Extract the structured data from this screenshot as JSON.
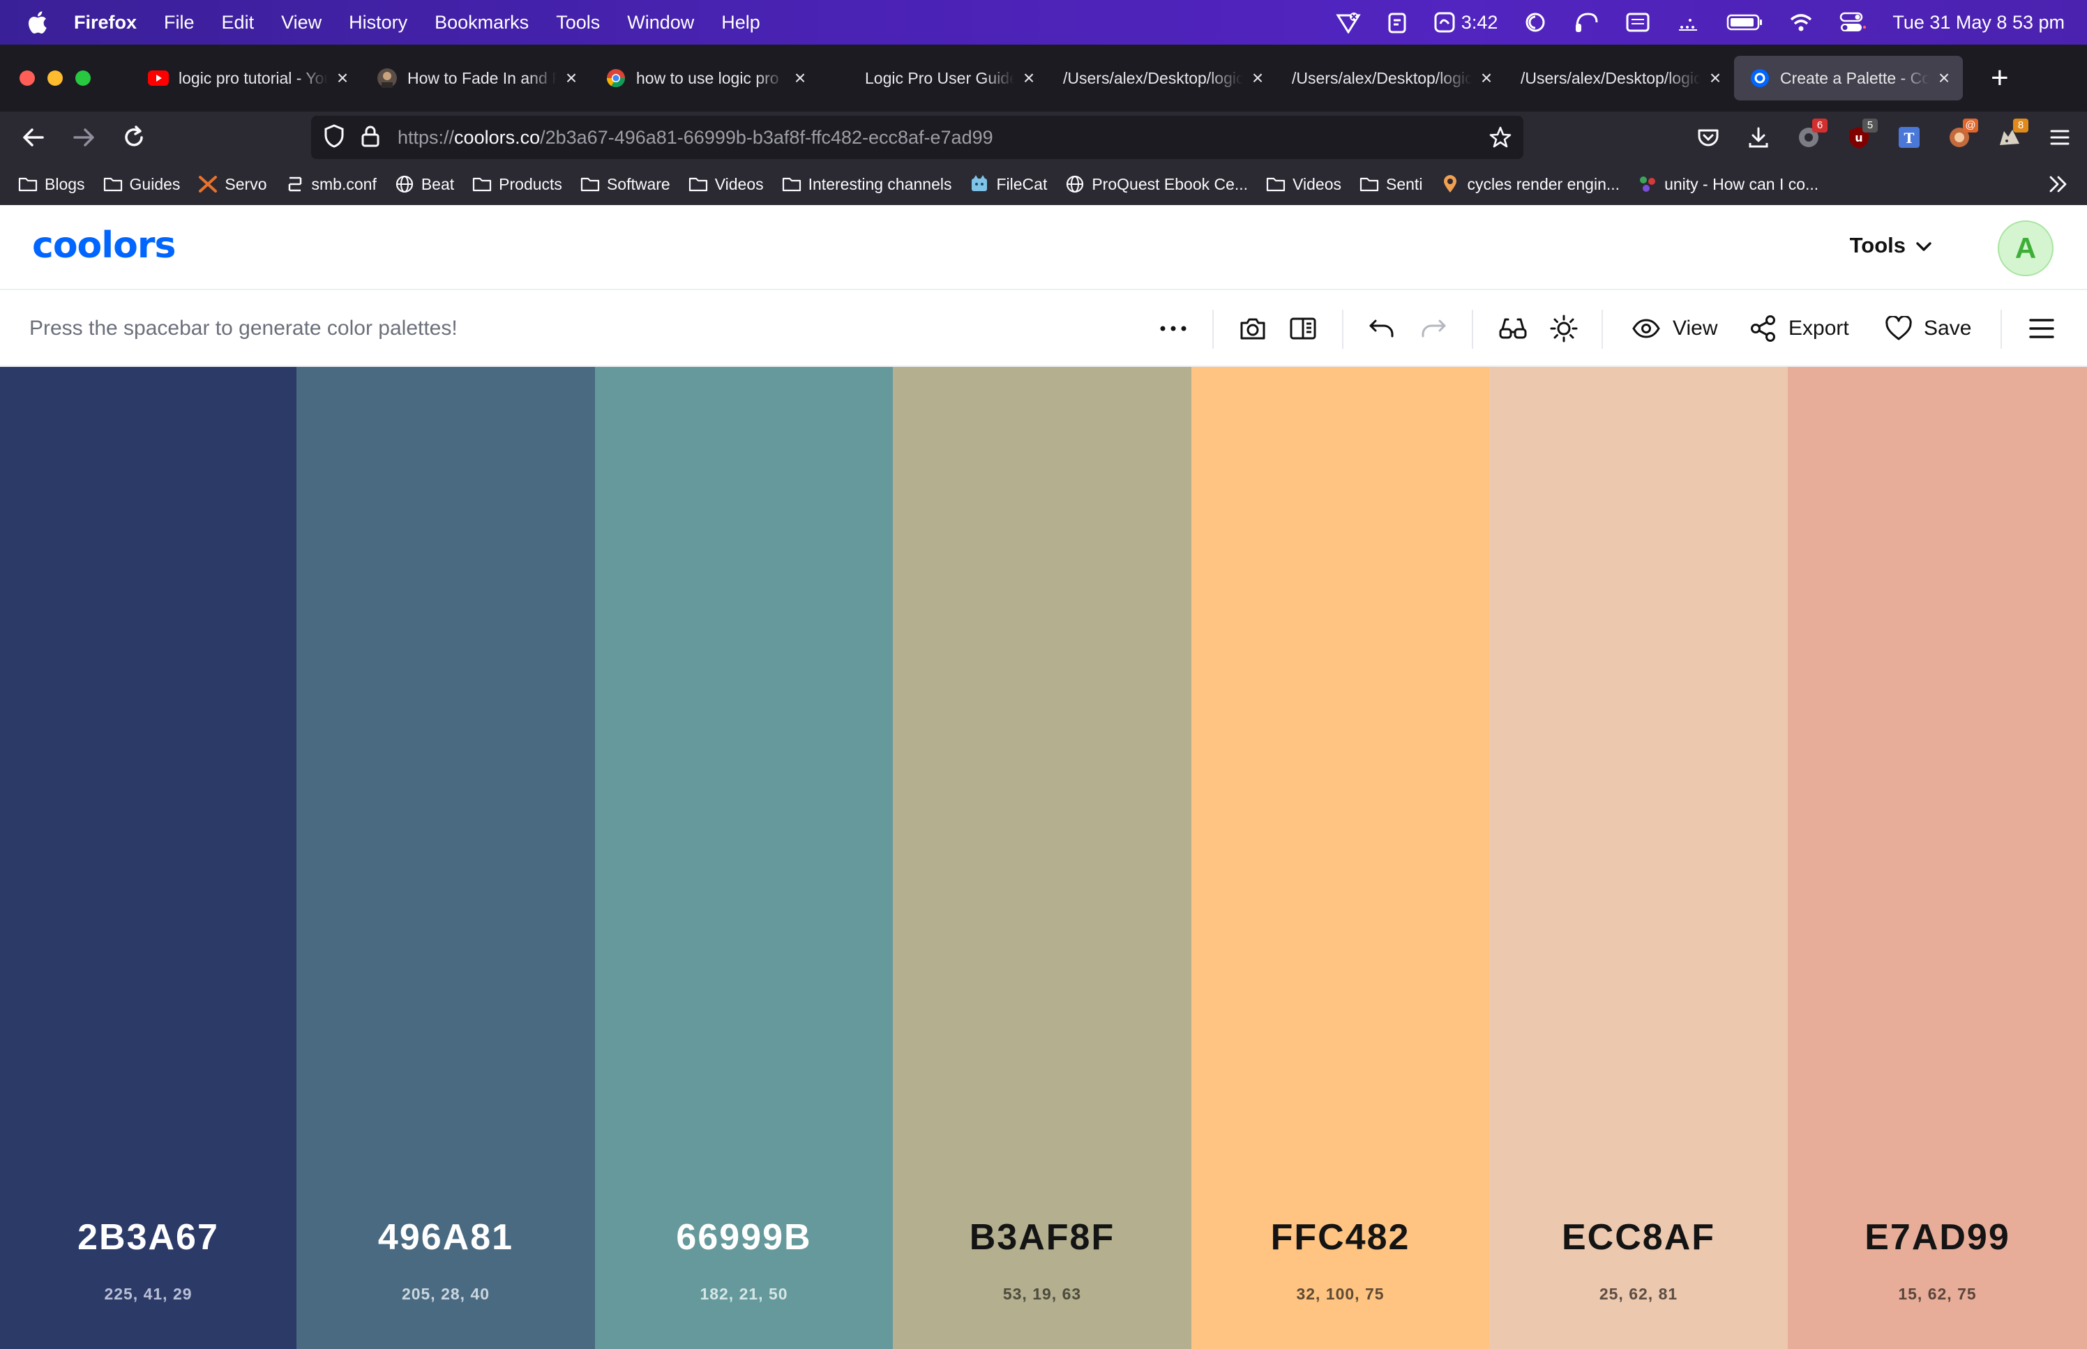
{
  "menubar": {
    "app_name": "Firefox",
    "items": [
      "File",
      "Edit",
      "View",
      "History",
      "Bookmarks",
      "Tools",
      "Window",
      "Help"
    ],
    "timer": "3:42",
    "datetime": "Tue 31 May  8 53 pm"
  },
  "tabs": [
    {
      "title": "logic pro tutorial - YouTube",
      "icon": "youtube-icon",
      "active": false
    },
    {
      "title": "How to Fade In and Fade Out",
      "icon": "avatar-icon",
      "active": false
    },
    {
      "title": "how to use logic pro",
      "icon": "chrome-icon",
      "active": false
    },
    {
      "title": "Logic Pro User Guide - logic",
      "icon": "",
      "active": false
    },
    {
      "title": "/Users/alex/Desktop/logic",
      "icon": "",
      "active": false
    },
    {
      "title": "/Users/alex/Desktop/logic",
      "icon": "",
      "active": false
    },
    {
      "title": "/Users/alex/Desktop/logic",
      "icon": "",
      "active": false
    },
    {
      "title": "Create a Palette - Coolors",
      "icon": "coolors-icon",
      "active": true
    }
  ],
  "urlbar": {
    "scheme": "https://",
    "host": "coolors.co",
    "path": "/2b3a67-496a81-66999b-b3af8f-ffc482-ecc8af-e7ad99"
  },
  "extensions": [
    {
      "icon": "extension-red-icon",
      "badge": "6",
      "badge_color": "#d32f2f"
    },
    {
      "icon": "ublock-icon",
      "badge": "5",
      "badge_color": "#555555"
    },
    {
      "icon": "translate-icon",
      "badge": "",
      "badge_color": ""
    },
    {
      "icon": "extension-orange-icon",
      "badge": "@",
      "badge_color": "#e0662c"
    },
    {
      "icon": "extension-cat-icon",
      "badge": "8",
      "badge_color": "#e08a1c"
    }
  ],
  "bookmarks": [
    {
      "label": "Blogs",
      "icon": "folder-icon"
    },
    {
      "label": "Guides",
      "icon": "folder-icon"
    },
    {
      "label": "Servo",
      "icon": "servo-icon"
    },
    {
      "label": "smb.conf",
      "icon": "smb-icon"
    },
    {
      "label": "Beat",
      "icon": "globe-icon"
    },
    {
      "label": "Products",
      "icon": "folder-icon"
    },
    {
      "label": "Software",
      "icon": "folder-icon"
    },
    {
      "label": "Videos",
      "icon": "folder-icon"
    },
    {
      "label": "Interesting channels",
      "icon": "folder-icon"
    },
    {
      "label": "FileCat",
      "icon": "filecat-icon"
    },
    {
      "label": "ProQuest Ebook Ce...",
      "icon": "globe-icon"
    },
    {
      "label": "Videos",
      "icon": "folder-icon"
    },
    {
      "label": "Senti",
      "icon": "folder-icon"
    },
    {
      "label": "cycles render engin...",
      "icon": "pin-icon"
    },
    {
      "label": "unity - How can I co...",
      "icon": "stackexchange-icon"
    }
  ],
  "site": {
    "logo": "coolors",
    "tools_label": "Tools",
    "avatar_letter": "A"
  },
  "toolbar": {
    "hint": "Press the spacebar to generate color palettes!",
    "view_label": "View",
    "export_label": "Export",
    "save_label": "Save"
  },
  "palette": [
    {
      "hex": "2B3A67",
      "hsb": "225, 41, 29",
      "color": "#2b3a67",
      "text_color": "#ffffff",
      "sub_color": "#b9c0d6"
    },
    {
      "hex": "496A81",
      "hsb": "205, 28, 40",
      "color": "#496a81",
      "text_color": "#ffffff",
      "sub_color": "#cbd6de"
    },
    {
      "hex": "66999B",
      "hsb": "182, 21, 50",
      "color": "#66999b",
      "text_color": "#ffffff",
      "sub_color": "#d6e6e6"
    },
    {
      "hex": "B3AF8F",
      "hsb": "53, 19, 63",
      "color": "#b3af8f",
      "text_color": "#141414",
      "sub_color": "#4d4b3c"
    },
    {
      "hex": "FFC482",
      "hsb": "32, 100, 75",
      "color": "#ffc482",
      "text_color": "#141414",
      "sub_color": "#5e4a33"
    },
    {
      "hex": "ECC8AF",
      "hsb": "25, 62, 81",
      "color": "#ecc8af",
      "text_color": "#141414",
      "sub_color": "#5b4d43"
    },
    {
      "hex": "E7AD99",
      "hsb": "15, 62, 75",
      "color": "#e7ad99",
      "text_color": "#141414",
      "sub_color": "#5b443c"
    }
  ]
}
